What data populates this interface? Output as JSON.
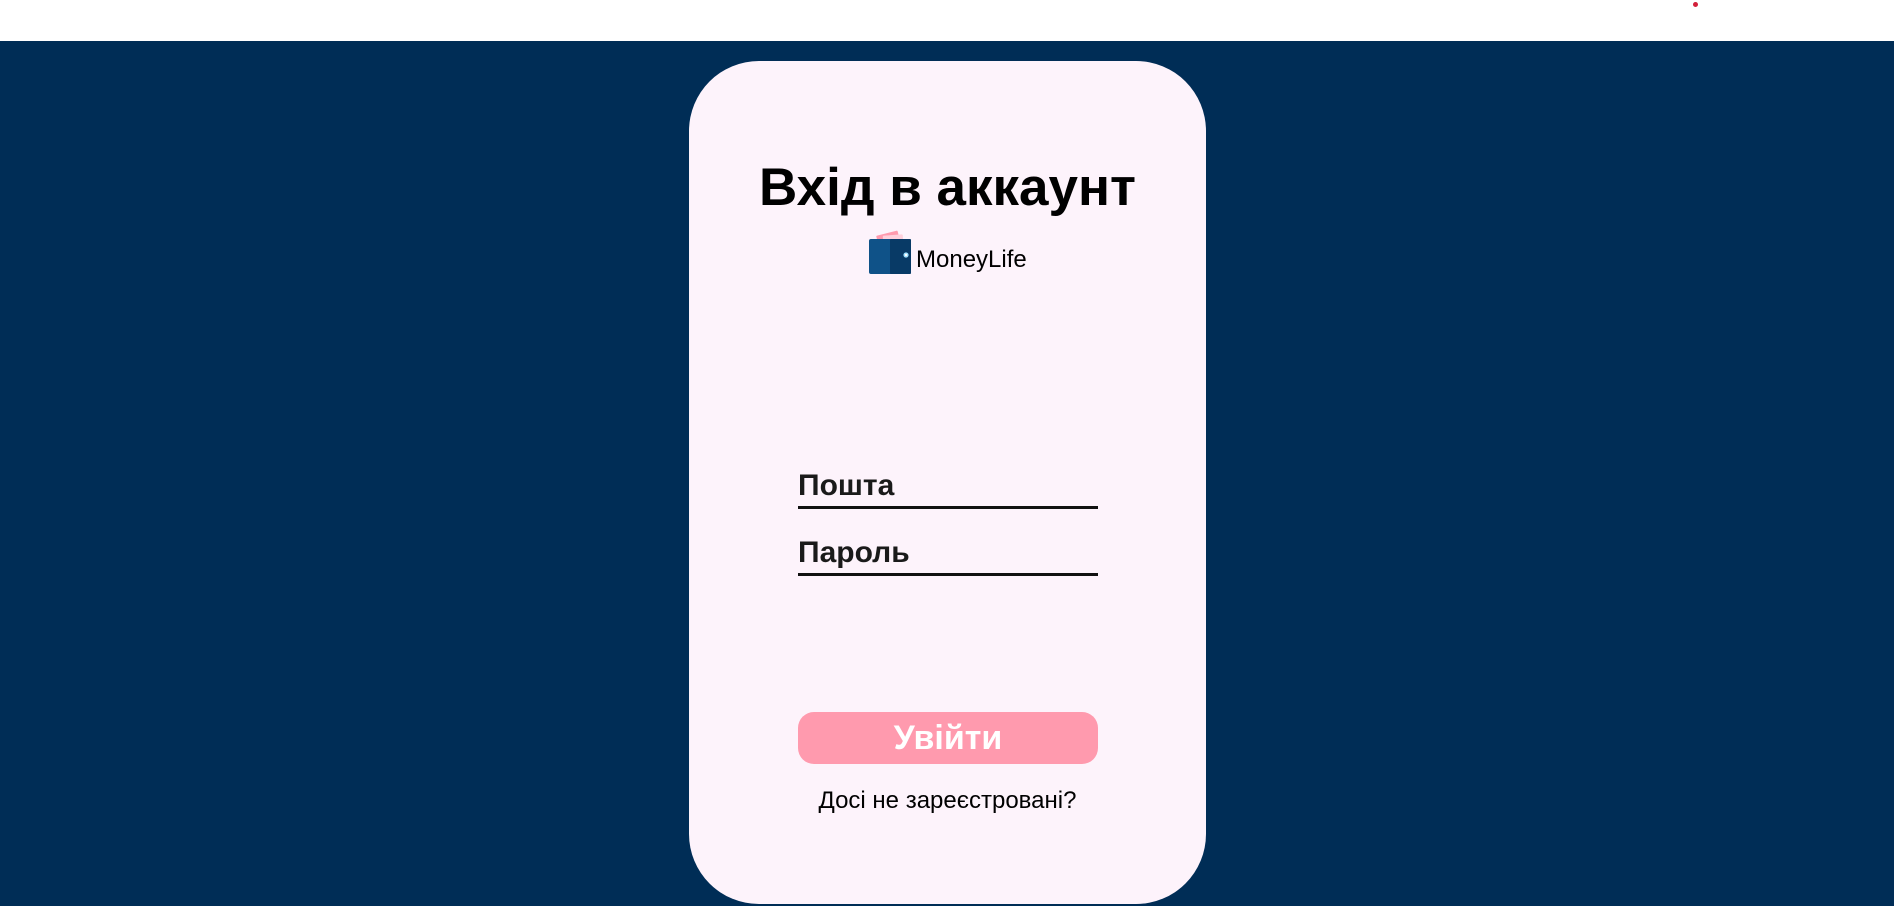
{
  "login": {
    "title": "Вхід в аккаунт",
    "brand_name": "MoneyLife",
    "brand_icon": "wallet-icon",
    "email_placeholder": "Пошта",
    "password_placeholder": "Пароль",
    "email_value": "",
    "password_value": "",
    "submit_label": "Увійти",
    "register_link": "Досі не зареєстровані?"
  },
  "colors": {
    "background": "#002d56",
    "card": "#fdf3fb",
    "button": "#ff9aae",
    "button_text": "#ffffff",
    "topbar": "#ffffff",
    "topbar_dot": "#d3203a"
  }
}
